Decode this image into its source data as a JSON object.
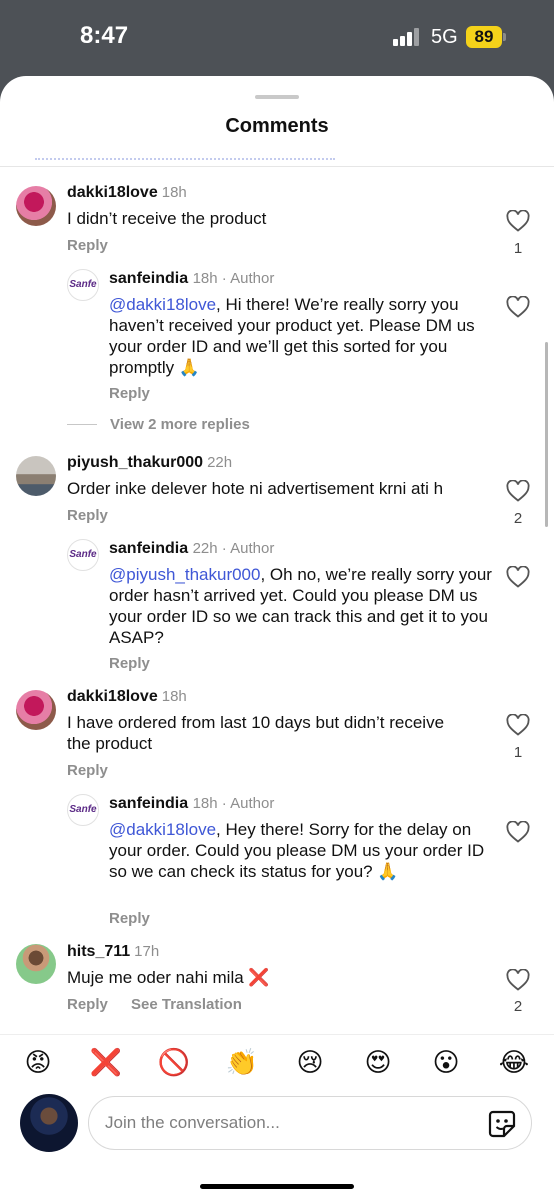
{
  "status": {
    "time": "8:47",
    "network": "5G",
    "battery": "89"
  },
  "sheet": {
    "title": "Comments"
  },
  "comments": [
    {
      "username": "dakki18love",
      "time": "18h",
      "text": "I didn’t receive the product",
      "reply_label": "Reply",
      "likes": "1",
      "reply": {
        "username": "sanfeindia",
        "meta": "18h · Author",
        "mention": "@dakki18love",
        "text": ", Hi there! We’re really sorry you haven’t received your product yet. Please DM us your order ID and we’ll get this sorted for you promptly 🙏",
        "reply_label": "Reply"
      },
      "view_more": "View 2 more replies"
    },
    {
      "username": "piyush_thakur000",
      "time": "22h",
      "text": "Order inke delever hote ni advertisement krni ati h",
      "reply_label": "Reply",
      "likes": "2",
      "reply": {
        "username": "sanfeindia",
        "meta": "22h · Author",
        "mention": "@piyush_thakur000",
        "text": ", Oh no, we’re really sorry your order hasn’t arrived yet. Could you please DM us your order ID so we can track this and get it to you ASAP?",
        "reply_label": "Reply"
      }
    },
    {
      "username": "dakki18love",
      "time": "18h",
      "text": "I have ordered from last 10 days but didn’t receive the product",
      "reply_label": "Reply",
      "likes": "1",
      "reply": {
        "username": "sanfeindia",
        "meta": "18h · Author",
        "mention": "@dakki18love",
        "text": ", Hey there! Sorry for the delay on your order. Could you please DM us your order ID so we can check its status for you? 🙏",
        "reply_label": "Reply"
      }
    },
    {
      "username": "hits_711",
      "time": "17h",
      "text": "Muje me oder nahi mila ❌",
      "reply_label": "Reply",
      "translate_label": "See Translation",
      "likes": "2"
    }
  ],
  "sanfe_logo": "Sanfe",
  "emoji_bar": [
    "😡",
    "❌",
    "🚫",
    "👏",
    "😢",
    "😍",
    "😮",
    "😂"
  ],
  "composer": {
    "placeholder": "Join the conversation..."
  },
  "icons": [
    "heart-icon",
    "sticker-icon"
  ]
}
